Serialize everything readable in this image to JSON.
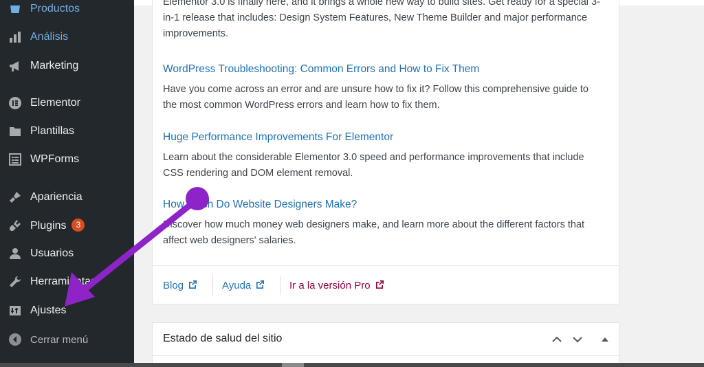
{
  "colors": {
    "sidebar_bg": "#23282d",
    "link_blue": "#2271b1",
    "pro_link": "#93003f",
    "badge_orange": "#d54e21",
    "annotation_purple": "#8e24c8"
  },
  "sidebar": {
    "items": [
      {
        "label": "Productos",
        "icon": "products-icon"
      },
      {
        "label": "Análisis",
        "icon": "bar-chart-icon"
      },
      {
        "label": "Marketing",
        "icon": "megaphone-icon"
      },
      {
        "label": "Elementor",
        "icon": "elementor-icon"
      },
      {
        "label": "Plantillas",
        "icon": "folder-icon"
      },
      {
        "label": "WPForms",
        "icon": "form-icon"
      },
      {
        "label": "Apariencia",
        "icon": "paintbrush-icon"
      },
      {
        "label": "Plugins",
        "icon": "plug-icon",
        "badge": "3"
      },
      {
        "label": "Usuarios",
        "icon": "user-icon"
      },
      {
        "label": "Herramientas",
        "icon": "wrench-icon"
      },
      {
        "label": "Ajustes",
        "icon": "settings-icon"
      },
      {
        "label": "Cerrar menú",
        "icon": "collapse-icon"
      }
    ]
  },
  "news": {
    "intro_partial": "Elementor 3.0 is finally here, and it brings a whole new way to build sites. Get ready for a special 3-in-1 release that includes: Design System Features, New Theme Builder and major performance improvements.",
    "items": [
      {
        "title": "WordPress Troubleshooting: Common Errors and How to Fix Them",
        "desc": "Have you come across an error and are unsure how to fix it? Follow this comprehensive guide to the most common WordPress errors and learn how to fix them."
      },
      {
        "title": "Huge Performance Improvements For Elementor",
        "desc": "Learn about the considerable Elementor 3.0 speed and performance improvements that include CSS rendering and DOM element removal."
      },
      {
        "title": "How Much Do Website Designers Make?",
        "desc": "Discover how much money web designers make, and learn more about the different factors that affect web designers' salaries."
      }
    ]
  },
  "footer_links": {
    "blog": "Blog",
    "help": "Ayuda",
    "pro": "Ir a la versión Pro"
  },
  "site_health": {
    "title": "Estado de salud del sitio"
  }
}
